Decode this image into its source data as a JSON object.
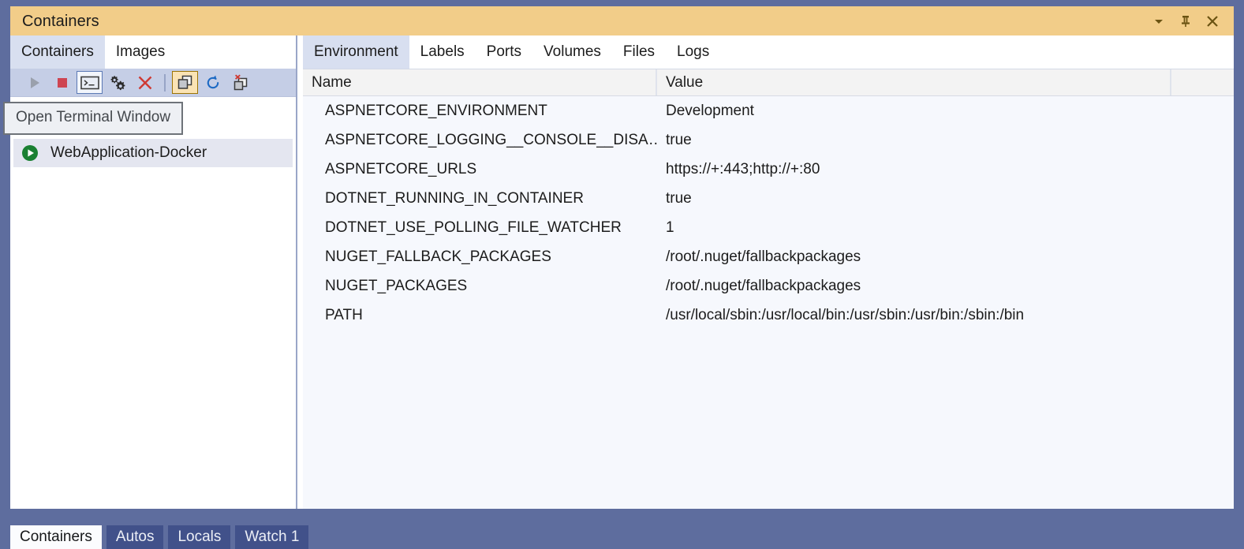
{
  "window": {
    "title": "Containers",
    "controls": [
      {
        "name": "chevron-down-icon",
        "label": "Window options"
      },
      {
        "name": "pin-icon",
        "label": "Auto Hide"
      },
      {
        "name": "close-icon",
        "label": "Close"
      }
    ],
    "title_bar_color": "#f2cd89",
    "frame_color": "#5e6d9e"
  },
  "left_panel": {
    "tabs": [
      {
        "label": "Containers",
        "active": true
      },
      {
        "label": "Images",
        "active": false
      }
    ],
    "toolbar": [
      {
        "name": "start-button",
        "label": "Start",
        "state": "disabled"
      },
      {
        "name": "stop-button",
        "label": "Stop",
        "state": "enabled"
      },
      {
        "name": "open-terminal-window-button",
        "label": "Open Terminal Window",
        "state": "selected"
      },
      {
        "name": "view-settings-button",
        "label": "Settings",
        "state": "enabled"
      },
      {
        "name": "remove-container-button",
        "label": "Remove",
        "state": "enabled"
      },
      {
        "name": "show-containers-button",
        "label": "Show Containers",
        "state": "toggled"
      },
      {
        "name": "refresh-button",
        "label": "Refresh",
        "state": "enabled"
      },
      {
        "name": "prune-containers-button",
        "label": "Prune Containers",
        "state": "enabled"
      }
    ],
    "tooltip": "Open Terminal Window",
    "containers": [
      {
        "name": "WebApplication-Docker",
        "status": "running"
      }
    ]
  },
  "right_panel": {
    "tabs": [
      {
        "label": "Environment",
        "active": true
      },
      {
        "label": "Labels",
        "active": false
      },
      {
        "label": "Ports",
        "active": false
      },
      {
        "label": "Volumes",
        "active": false
      },
      {
        "label": "Files",
        "active": false
      },
      {
        "label": "Logs",
        "active": false
      }
    ],
    "table": {
      "columns": [
        "Name",
        "Value",
        ""
      ],
      "rows": [
        {
          "name": "ASPNETCORE_ENVIRONMENT",
          "value": "Development"
        },
        {
          "name": "ASPNETCORE_LOGGING__CONSOLE__DISA…",
          "value": "true"
        },
        {
          "name": "ASPNETCORE_URLS",
          "value": "https://+:443;http://+:80"
        },
        {
          "name": "DOTNET_RUNNING_IN_CONTAINER",
          "value": "true"
        },
        {
          "name": "DOTNET_USE_POLLING_FILE_WATCHER",
          "value": "1"
        },
        {
          "name": "NUGET_FALLBACK_PACKAGES",
          "value": "/root/.nuget/fallbackpackages"
        },
        {
          "name": "NUGET_PACKAGES",
          "value": "/root/.nuget/fallbackpackages"
        },
        {
          "name": "PATH",
          "value": "/usr/local/sbin:/usr/local/bin:/usr/sbin:/usr/bin:/sbin:/bin"
        }
      ]
    }
  },
  "bottom_tabs": [
    {
      "label": "Containers",
      "active": true
    },
    {
      "label": "Autos",
      "active": false
    },
    {
      "label": "Locals",
      "active": false
    },
    {
      "label": "Watch 1",
      "active": false
    }
  ]
}
